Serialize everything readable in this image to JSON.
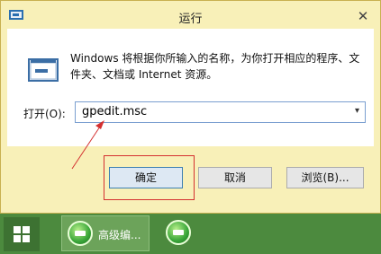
{
  "window": {
    "title": "运行",
    "close_glyph": "✕",
    "icon": "run-window-icon"
  },
  "dialog": {
    "description": "Windows 将根据你所输入的名称，为你打开相应的程序、文件夹、文档或 Internet 资源。",
    "open_label": "打开(O):",
    "command_value": "gpedit.msc",
    "dropdown_glyph": "▾"
  },
  "buttons": {
    "ok": "确定",
    "cancel": "取消",
    "browse": "浏览(B)..."
  },
  "taskbar": {
    "start_icon": "windows-logo-icon",
    "active_task_label": "高级编...",
    "active_task_icon": "green-app-icon",
    "second_task_icon": "green-app-icon"
  },
  "colors": {
    "window_frame": "#f8f0b8",
    "annotation": "#d43030",
    "taskbar": "#4c8a3e"
  }
}
